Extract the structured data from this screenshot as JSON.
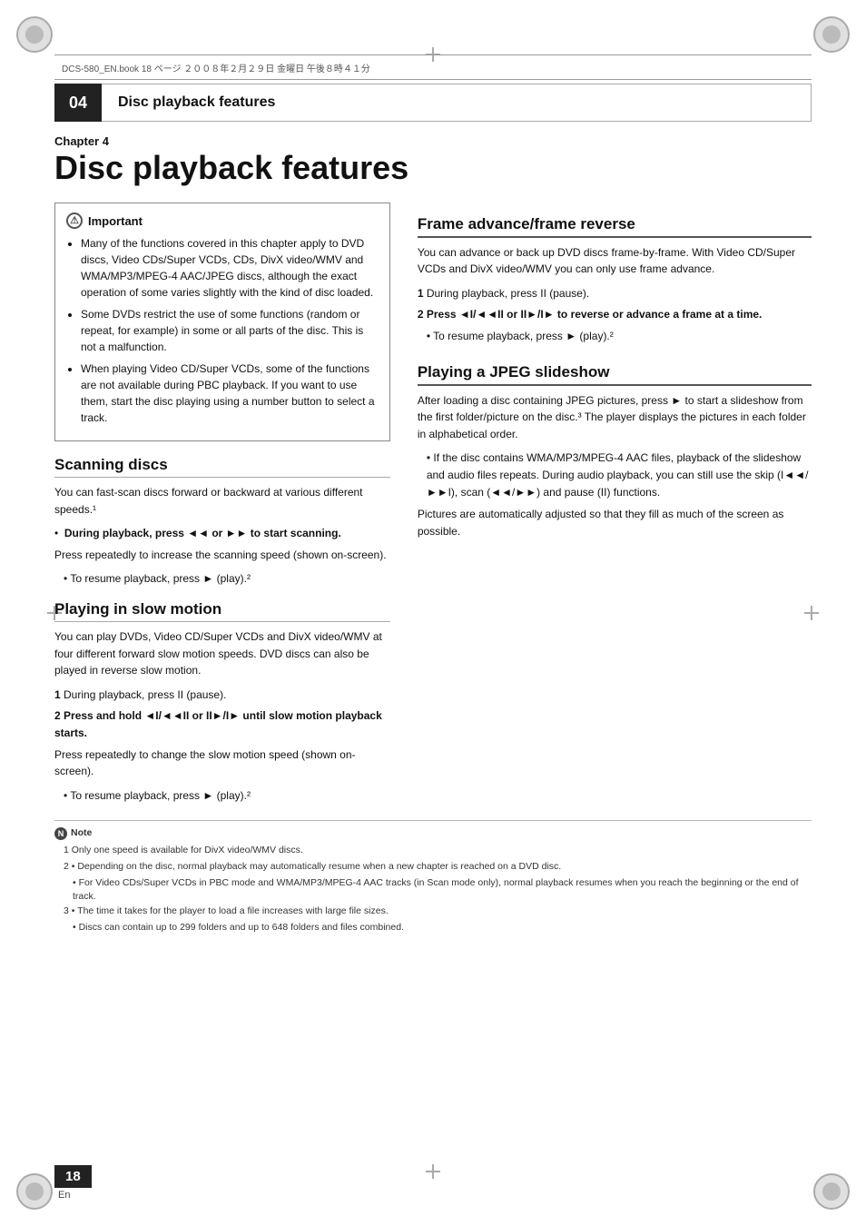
{
  "page": {
    "number": "18",
    "lang": "En"
  },
  "header": {
    "file_info": "DCS-580_EN.book   18 ページ   ２００８年２月２９日   金曜日   午後８時４１分",
    "chapter_number": "04",
    "chapter_title": "Disc playback features"
  },
  "chapter": {
    "label": "Chapter 4",
    "title": "Disc playback features"
  },
  "important": {
    "title": "Important",
    "bullets": [
      "Many of the functions covered in this chapter apply to DVD discs, Video CDs/Super VCDs, CDs, DivX video/WMV and WMA/MP3/MPEG-4 AAC/JPEG discs, although the exact operation of some varies slightly with the kind of disc loaded.",
      "Some DVDs restrict the use of some functions (random or repeat, for example) in some or all parts of the disc. This is not a malfunction.",
      "When playing Video CD/Super VCDs, some of the functions are not available during PBC playback. If you want to use them, start the disc playing using a number button to select a track."
    ]
  },
  "scanning": {
    "title": "Scanning discs",
    "body": "You can fast-scan discs forward or backward at various different speeds.¹",
    "step_bold": "During playback, press ◄◄ or ►► to start scanning.",
    "step_body": "Press repeatedly to increase the scanning speed (shown on-screen).",
    "resume": "To resume playback, press ► (play).²"
  },
  "slow_motion": {
    "title": "Playing in slow motion",
    "body": "You can play DVDs, Video CD/Super VCDs and DivX video/WMV at four different forward slow motion speeds. DVD discs can also be played in reverse slow motion.",
    "step1": "During playback, press II (pause).",
    "step2_bold": "Press and hold ◄I/◄◄II or II►/I► until slow motion playback starts.",
    "step2_body": "Press repeatedly to change the slow motion speed (shown on-screen).",
    "resume": "To resume playback, press ► (play).²"
  },
  "frame_advance": {
    "title": "Frame advance/frame reverse",
    "body": "You can advance or back up DVD discs frame-by-frame. With Video CD/Super VCDs and DivX video/WMV you can only use frame advance.",
    "step1": "During playback, press II (pause).",
    "step2_bold": "Press ◄I/◄◄II or II►/I► to reverse or advance a frame at a time.",
    "resume": "To resume playback, press ► (play).²"
  },
  "jpeg_slideshow": {
    "title": "Playing a JPEG slideshow",
    "body": "After loading a disc containing JPEG pictures, press ► to start a slideshow from the first folder/picture on the disc.³ The player displays the pictures in each folder in alphabetical order.",
    "bullet": "If the disc contains WMA/MP3/MPEG-4 AAC files, playback of the slideshow and audio files repeats. During audio playback, you can still use the skip (I◄◄/►►I), scan (◄◄/►►) and pause (II) functions.",
    "body2": "Pictures are automatically adjusted so that they fill as much of the screen as possible."
  },
  "notes": {
    "title": "Note",
    "items": [
      "1  Only one speed is available for DivX video/WMV discs.",
      "2  • Depending on the disc, normal playback may automatically resume when a new chapter is reached on a DVD disc.",
      "   • For Video CDs/Super VCDs in PBC mode and WMA/MP3/MPEG-4 AAC tracks (in Scan mode only), normal playback resumes when you reach the beginning or the end of track.",
      "3  • The time it takes for the player to load a file increases with large file sizes.",
      "   • Discs can contain up to 299 folders and up to 648 folders and files combined."
    ]
  }
}
